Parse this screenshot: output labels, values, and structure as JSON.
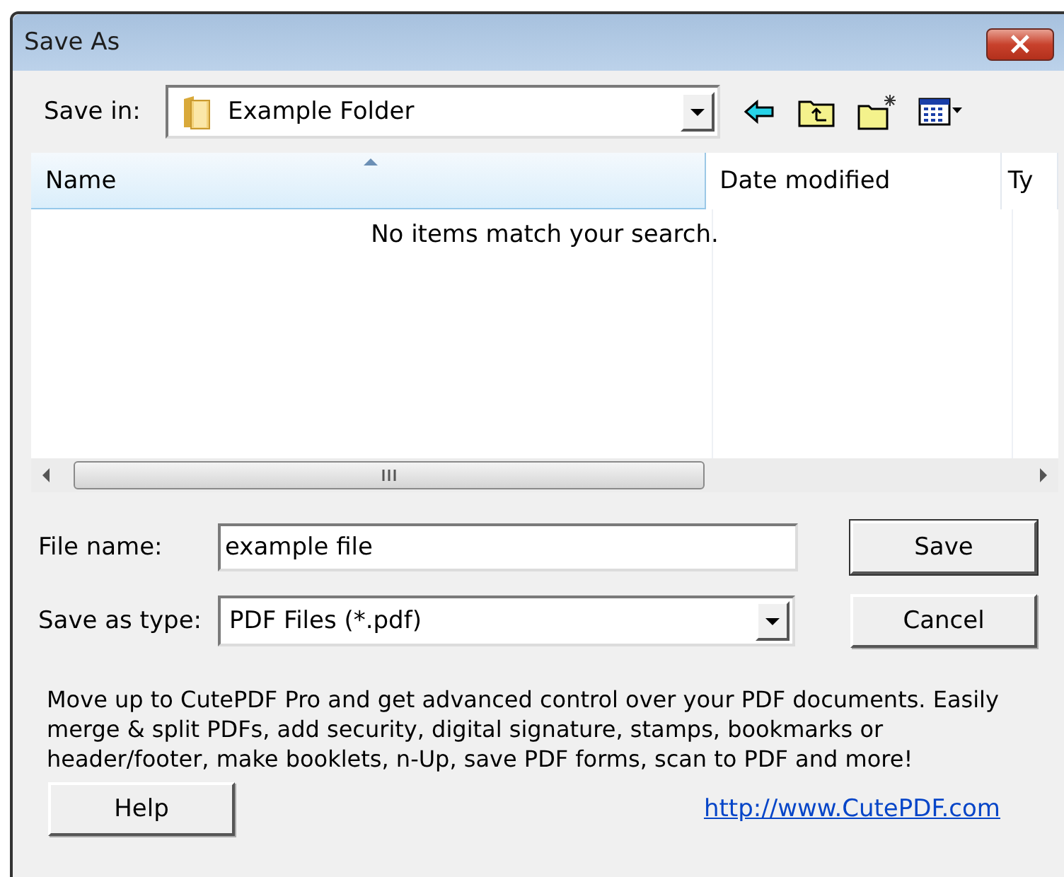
{
  "window": {
    "title": "Save As",
    "close": "×"
  },
  "save_in": {
    "label": "Save in:",
    "value": "Example Folder"
  },
  "toolbar": [
    {
      "kind": "back"
    },
    {
      "kind": "up"
    },
    {
      "kind": "new-folder"
    },
    {
      "kind": "view"
    }
  ],
  "file_list": {
    "columns": [
      {
        "label": "Name",
        "sorted": true
      },
      {
        "label": "Date modified",
        "sorted": false
      },
      {
        "label": "Ty",
        "sorted": false
      }
    ],
    "empty_message": "No items match your search."
  },
  "file_name": {
    "label": "File name:",
    "value": "example file"
  },
  "save_as_type": {
    "label": "Save as type:",
    "value": "PDF Files (*.pdf)"
  },
  "buttons": [
    {
      "kind": "save",
      "label": "Save"
    },
    {
      "kind": "cancel",
      "label": "Cancel"
    }
  ],
  "promo": "Move up to CutePDF Pro and get advanced control over your PDF documents. Easily merge & split PDFs, add security, digital signature, stamps, bookmarks or header/footer, make booklets, n-Up, save PDF forms, scan to PDF and more!",
  "help": {
    "label": "Help"
  },
  "link": "http://www.CutePDF.com"
}
